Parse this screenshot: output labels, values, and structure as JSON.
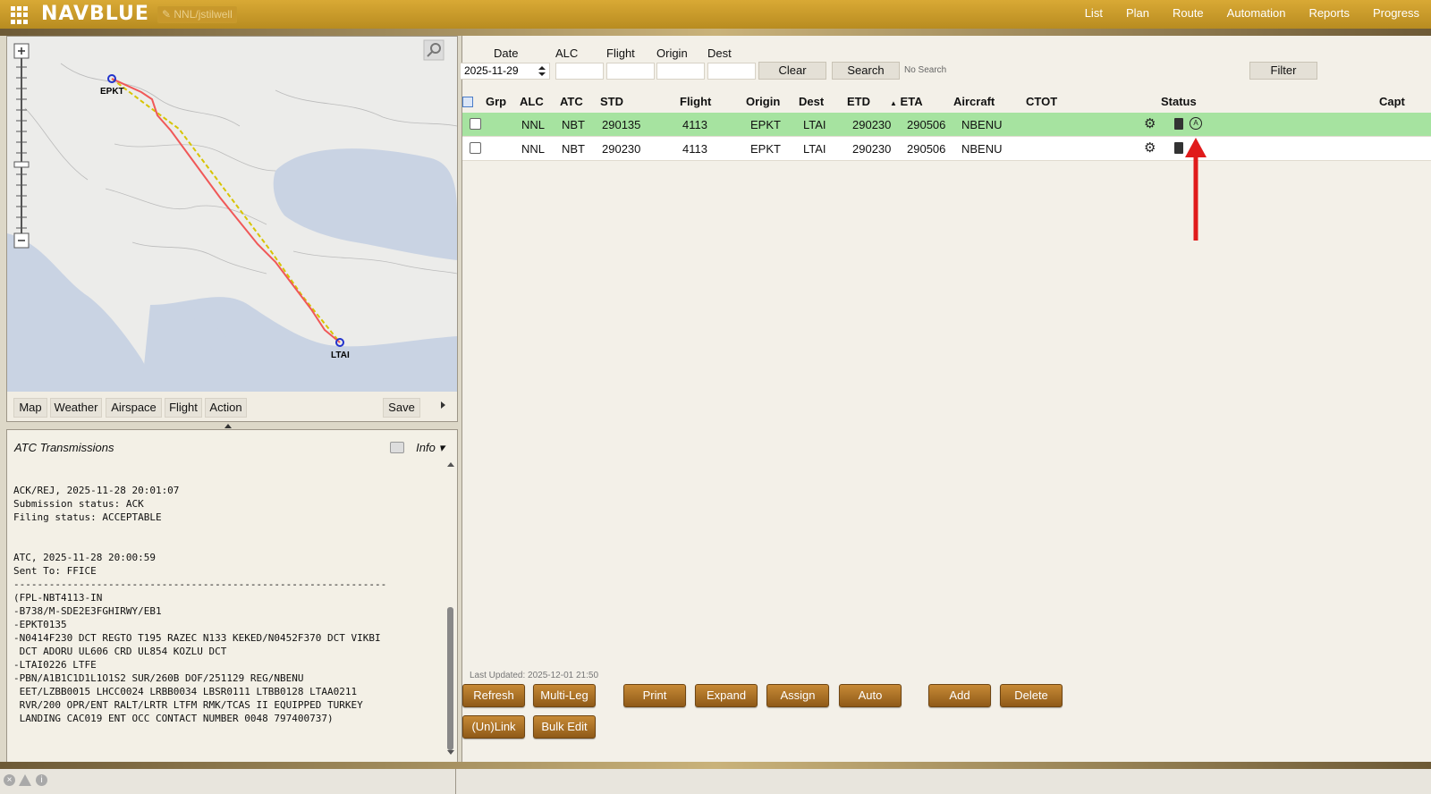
{
  "app": {
    "logo": "NAVBLUE",
    "user": "NNL/jstilwell"
  },
  "nav": [
    "List",
    "Plan",
    "Route",
    "Automation",
    "Reports",
    "Progress"
  ],
  "map": {
    "airports": [
      {
        "code": "EPKT"
      },
      {
        "code": "LTAI"
      }
    ],
    "toolbar": {
      "tabs": [
        "Map",
        "Weather",
        "Airspace",
        "Flight",
        "Action"
      ],
      "save": "Save"
    }
  },
  "atc": {
    "title": "ATC Transmissions",
    "info": "Info",
    "text": "ACK/REJ, 2025-11-28 20:01:07\nSubmission status: ACK\nFiling status: ACCEPTABLE\n\n\nATC, 2025-11-28 20:00:59\nSent To: FFICE\n---------------------------------------------------------------\n(FPL-NBT4113-IN\n-B738/M-SDE2E3FGHIRWY/EB1\n-EPKT0135\n-N0414F230 DCT REGTO T195 RAZEC N133 KEKED/N0452F370 DCT VIKBI\n DCT ADORU UL606 CRD UL854 KOZLU DCT\n-LTAI0226 LTFE\n-PBN/A1B1C1D1L1O1S2 SUR/260B DOF/251129 REG/NBENU\n EET/LZBB0015 LHCC0024 LRBB0034 LBSR0111 LTBB0128 LTAA0211\n RVR/200 OPR/ENT RALT/LRTR LTFM RMK/TCAS II EQUIPPED TURKEY\n LANDING CAC019 ENT OCC CONTACT NUMBER 0048 797400737)"
  },
  "search": {
    "labels": {
      "date": "Date",
      "alc": "ALC",
      "flight": "Flight",
      "origin": "Origin",
      "dest": "Dest"
    },
    "date_value": "2025-11-29",
    "clear": "Clear",
    "search": "Search",
    "no_search": "No Search",
    "filter": "Filter"
  },
  "table": {
    "headers": {
      "grp": "Grp",
      "alc": "ALC",
      "atc": "ATC",
      "std": "STD",
      "flight": "Flight",
      "origin": "Origin",
      "dest": "Dest",
      "etd": "ETD",
      "eta": "ETA",
      "aircraft": "Aircraft",
      "ctot": "CTOT",
      "status": "Status",
      "cap": "Capt"
    },
    "rows": [
      {
        "alc": "NNL",
        "atc": "NBT",
        "std": "290135",
        "flight": "4113",
        "origin": "EPKT",
        "dest": "LTAI",
        "etd": "290230",
        "eta": "290506",
        "aircraft": "NBENU",
        "highlight": true
      },
      {
        "alc": "NNL",
        "atc": "NBT",
        "std": "290230",
        "flight": "4113",
        "origin": "EPKT",
        "dest": "LTAI",
        "etd": "290230",
        "eta": "290506",
        "aircraft": "NBENU",
        "highlight": false
      }
    ]
  },
  "last_updated": "Last Updated: 2025-12-01 21:50",
  "actions": {
    "refresh": "Refresh",
    "multileg": "Multi-Leg",
    "print": "Print",
    "expand": "Expand",
    "assign": "Assign",
    "auto": "Auto",
    "add": "Add",
    "delete": "Delete",
    "unlink": "(Un)Link",
    "bulkedit": "Bulk Edit"
  },
  "colors": {
    "highlight_row": "#a6e3a0",
    "gold": "#c8982b",
    "arrow": "#e01b1b"
  }
}
